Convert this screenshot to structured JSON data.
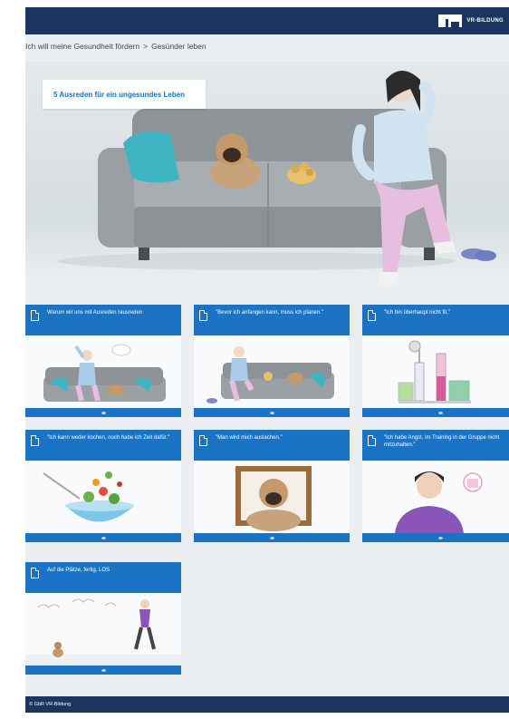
{
  "header": {
    "logo_text": "VR-BILDUNG"
  },
  "breadcrumb": {
    "first": "Ich will meine Gesundheit fördern",
    "separator": ">",
    "current": "Gesünder leben"
  },
  "hero": {
    "title": "5 Ausreden für ein ungesundes Leben"
  },
  "tiles": [
    {
      "title": "Warum wir uns mit Ausreden rausreden"
    },
    {
      "title": "\"Bevor ich anfangen kann, muss ich planen.\""
    },
    {
      "title": "\"Ich bin überhaupt nicht fit.\""
    },
    {
      "title": "\"Ich kann weder kochen, noch habe ich Zeit dafür.\""
    },
    {
      "title": "\"Man wird mich auslachen.\""
    },
    {
      "title": "\"Ich habe Angst, im Training in der Gruppe nicht mitzuhalten.\""
    },
    {
      "title": "Auf die Plätze, fertig, LOS"
    }
  ],
  "footer": {
    "copyright": "© GbR VR-Bildung"
  }
}
